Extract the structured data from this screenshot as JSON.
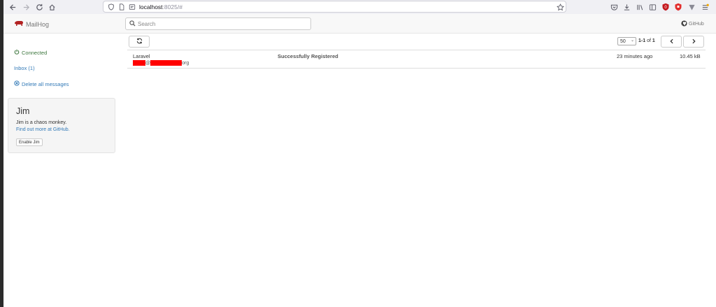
{
  "browser": {
    "url_host": "localhost",
    "url_rest": ":8025/#"
  },
  "app": {
    "brand": "MailHog",
    "search_placeholder": "Search",
    "github_label": "GitHub"
  },
  "sidebar": {
    "connected_label": "Connected",
    "inbox_label": "Inbox (1)",
    "delete_all_label": "Delete all messages"
  },
  "jim": {
    "title": "Jim",
    "description": "Jim is a chaos monkey.",
    "link_text": "Find out more at GitHub.",
    "button_label": "Enable Jim"
  },
  "toolbar": {
    "per_page": "50",
    "range": "1-1",
    "of_word": "of",
    "total": "1"
  },
  "messages": [
    {
      "from": "Laravel",
      "to_at": "@",
      "to_tail": "org",
      "subject": "Successfully Registered",
      "time": "23 minutes ago",
      "size": "10.45 kB"
    }
  ],
  "colors": {
    "link": "#337ab7",
    "connected": "#3c763d",
    "brand_logo": "#b22222",
    "redaction": "#ff0000"
  }
}
